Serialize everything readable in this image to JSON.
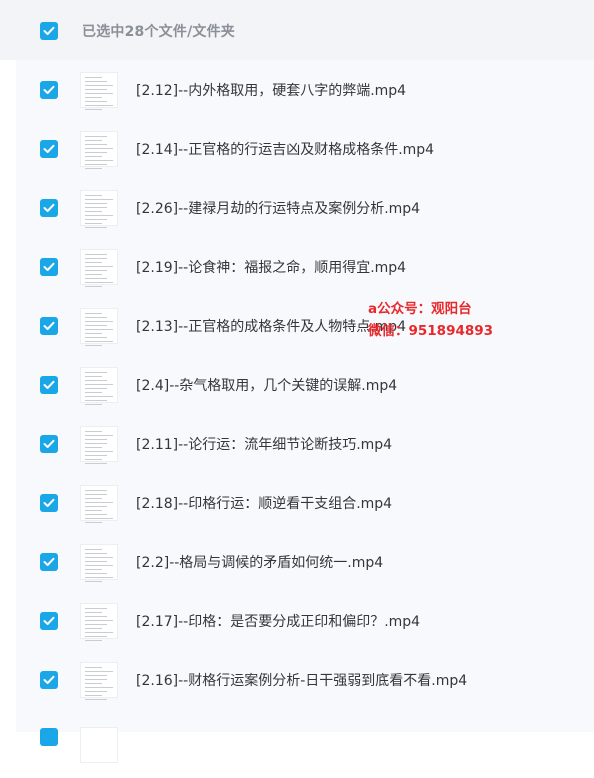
{
  "header": {
    "title": "已选中28个文件/文件夹",
    "checked": true
  },
  "files": [
    {
      "name": "[2.12]--内外格取用，硬套八字的弊端.mp4",
      "checked": true
    },
    {
      "name": "[2.14]--正官格的行运吉凶及财格成格条件.mp4",
      "checked": true
    },
    {
      "name": "[2.26]--建禄月劫的行运特点及案例分析.mp4",
      "checked": true
    },
    {
      "name": "[2.19]--论食神：福报之命，顺用得宜.mp4",
      "checked": true
    },
    {
      "name": "[2.13]--正官格的成格条件及人物特点.mp4",
      "checked": true
    },
    {
      "name": "[2.4]--杂气格取用，几个关键的误解.mp4",
      "checked": true
    },
    {
      "name": "[2.11]--论行运：流年细节论断技巧.mp4",
      "checked": true
    },
    {
      "name": "[2.18]--印格行运：顺逆看干支组合.mp4",
      "checked": true
    },
    {
      "name": "[2.2]--格局与调候的矛盾如何统一.mp4",
      "checked": true
    },
    {
      "name": "[2.17]--印格：是否要分成正印和偏印？.mp4",
      "checked": true
    },
    {
      "name": "[2.16]--财格行运案例分析-日干强弱到底看不看.mp4",
      "checked": true
    }
  ],
  "watermark": {
    "line1": "a公众号：观阳台",
    "line2": "微信：951894893"
  },
  "colors": {
    "accent": "#1aa7e8",
    "watermark": "#e8292c"
  }
}
